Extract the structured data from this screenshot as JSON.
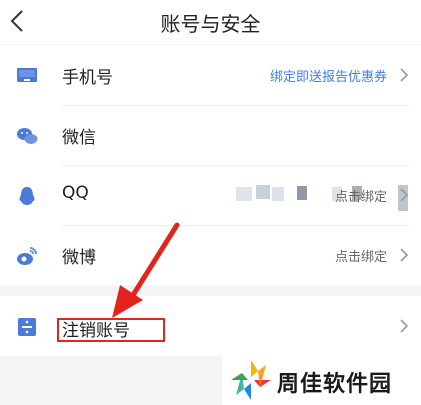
{
  "header": {
    "title": "账号与安全"
  },
  "items": [
    {
      "label": "手机号",
      "value": "绑定即送报告优惠券",
      "icon": "phone-icon"
    },
    {
      "label": "微信",
      "value": "",
      "icon": "wechat-icon"
    },
    {
      "label": "QQ",
      "value": "点击绑定",
      "icon": "qq-icon"
    },
    {
      "label": "微博",
      "value": "点击绑定",
      "icon": "weibo-icon"
    }
  ],
  "cancel": {
    "label": "注销账号",
    "icon": "cancel-account-icon"
  },
  "watermark": {
    "text": "周佳软件园"
  },
  "colors": {
    "accent": "#3c7ee8",
    "annotation": "#e0251d"
  }
}
